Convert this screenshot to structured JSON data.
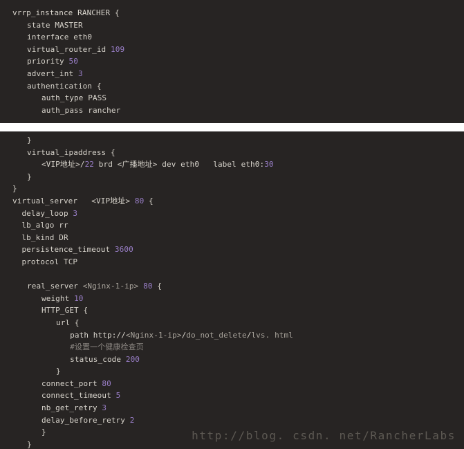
{
  "image": {
    "title": "Keepalived configuration code snippet",
    "background_color": "#272423",
    "gap_color": "#ffffff",
    "default_text_color": "#d8d4cc",
    "number_color": "#9a7fc8",
    "comment_color": "#8a8580"
  },
  "watermark": {
    "text": "http://blog. csdn. net/RancherLabs"
  },
  "panels": [
    {
      "name": "panel-top",
      "lines": [
        {
          "id": "l1",
          "indent": 0,
          "text": "vrrp_instance RANCHER {"
        },
        {
          "id": "l2",
          "indent": 1,
          "text": "state MASTER"
        },
        {
          "id": "l3",
          "indent": 1,
          "text": "interface eth0"
        },
        {
          "id": "l4",
          "indent": 1,
          "text": "virtual_router_id 109"
        },
        {
          "id": "l5",
          "indent": 1,
          "text": "priority 50"
        },
        {
          "id": "l6",
          "indent": 1,
          "text": "advert_int 3"
        },
        {
          "id": "l7",
          "indent": 1,
          "text": "authentication {"
        },
        {
          "id": "l8",
          "indent": 2,
          "text": "auth_type PASS"
        },
        {
          "id": "l9",
          "indent": 2,
          "text": "auth_pass rancher"
        }
      ]
    },
    {
      "name": "panel-bottom",
      "lines": [
        {
          "id": "b1",
          "indent": 1,
          "text": "}"
        },
        {
          "id": "b2",
          "indent": 1,
          "text": "virtual_ipaddress {"
        },
        {
          "id": "b3",
          "indent": 2,
          "text": "<VIP地址>/22 brd <广播地址> dev eth0   label eth0:30"
        },
        {
          "id": "b4",
          "indent": 1,
          "text": "}"
        },
        {
          "id": "b5",
          "indent": 0,
          "text": "}"
        },
        {
          "id": "b6",
          "indent": 0,
          "text": "virtual_server   <VIP地址> 80 {"
        },
        {
          "id": "b7",
          "indent": 0,
          "text": "  delay_loop 3"
        },
        {
          "id": "b8",
          "indent": 0,
          "text": "  lb_algo rr"
        },
        {
          "id": "b9",
          "indent": 0,
          "text": "  lb_kind DR"
        },
        {
          "id": "b10",
          "indent": 0,
          "text": "  persistence_timeout 3600"
        },
        {
          "id": "b11",
          "indent": 0,
          "text": "  protocol TCP"
        },
        {
          "id": "b12",
          "indent": 0,
          "text": ""
        },
        {
          "id": "b13",
          "indent": 1,
          "text": "real_server <Nginx-1-ip> 80 {"
        },
        {
          "id": "b14",
          "indent": 2,
          "text": "weight 10"
        },
        {
          "id": "b15",
          "indent": 2,
          "text": "HTTP_GET {"
        },
        {
          "id": "b16",
          "indent": 3,
          "text": "url {"
        },
        {
          "id": "b17",
          "indent": 3,
          "text": "   path http://<Nginx-1-ip>/do_not_delete/lvs. html"
        },
        {
          "id": "b18",
          "indent": 3,
          "text": "   #设置一个健康检查页"
        },
        {
          "id": "b19",
          "indent": 3,
          "text": "   status_code 200"
        },
        {
          "id": "b20",
          "indent": 3,
          "text": "}"
        },
        {
          "id": "b21",
          "indent": 2,
          "text": "connect_port 80"
        },
        {
          "id": "b22",
          "indent": 2,
          "text": "connect_timeout 5"
        },
        {
          "id": "b23",
          "indent": 2,
          "text": "nb_get_retry 3"
        },
        {
          "id": "b24",
          "indent": 2,
          "text": "delay_before_retry 2"
        },
        {
          "id": "b25",
          "indent": 2,
          "text": "}"
        },
        {
          "id": "b26",
          "indent": 1,
          "text": "}"
        }
      ]
    }
  ],
  "tokens": {
    "numbers": [
      "109",
      "50",
      "3",
      "22",
      "30",
      "80",
      "3600",
      "10",
      "200",
      "5",
      "2"
    ],
    "comments": [
      "#设置一个健康检查页"
    ]
  }
}
